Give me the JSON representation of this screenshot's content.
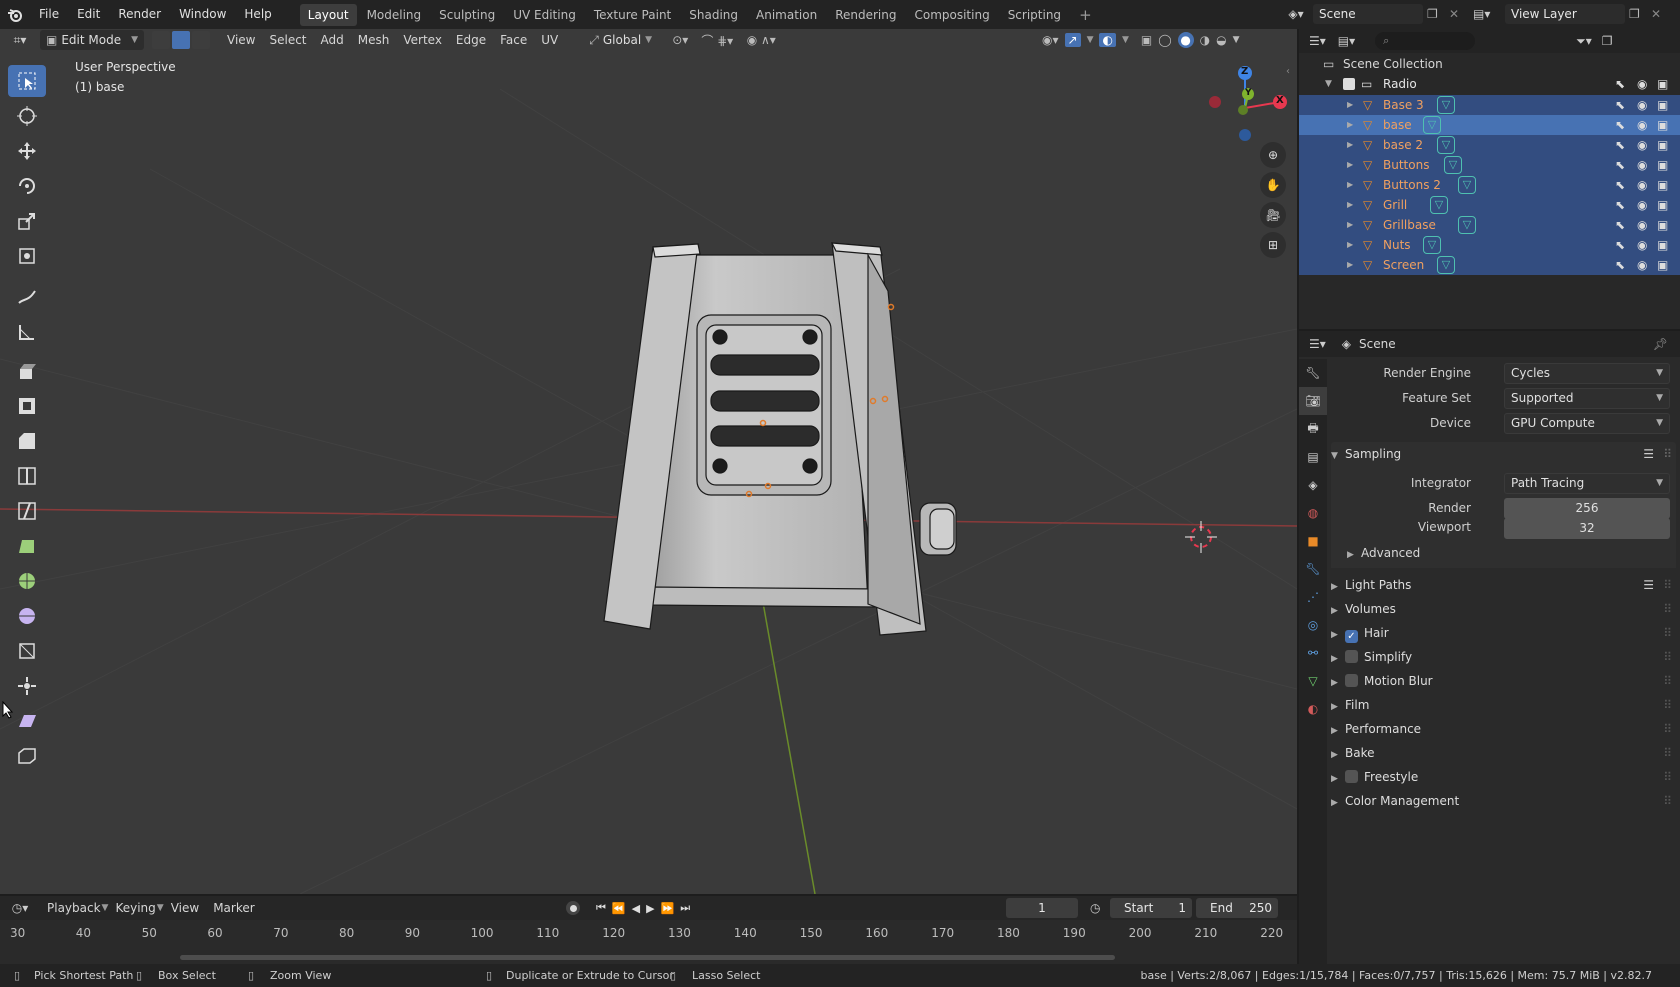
{
  "topbar": {
    "menus": [
      "File",
      "Edit",
      "Render",
      "Window",
      "Help"
    ],
    "workspaces": [
      "Layout",
      "Modeling",
      "Sculpting",
      "UV Editing",
      "Texture Paint",
      "Shading",
      "Animation",
      "Rendering",
      "Compositing",
      "Scripting"
    ],
    "active_workspace": "Layout",
    "add_tab": "+",
    "scene_name": "Scene",
    "view_layer_name": "View Layer"
  },
  "viewport": {
    "mode": "Edit Mode",
    "menus": [
      "View",
      "Select",
      "Add",
      "Mesh",
      "Vertex",
      "Edge",
      "Face",
      "UV"
    ],
    "orientation": "Global",
    "overlay_title": "User Perspective",
    "overlay_object": "(1) base",
    "gizmo_axes": {
      "x": "X",
      "y": "Y",
      "z": "Z"
    },
    "colors": {
      "x_axis": "#e8384f",
      "y_axis": "#7fb32d",
      "z_axis": "#3f84e5",
      "active_tool": "#4772b3"
    }
  },
  "tools": [
    "select-box-icon",
    "cursor-icon",
    "move-icon",
    "rotate-icon",
    "scale-icon",
    "transform-icon",
    "annotate-icon",
    "measure-icon",
    "extrude-icon",
    "inset-icon",
    "bevel-icon",
    "loop-cut-icon",
    "knife-icon",
    "poly-build-icon",
    "spin-icon",
    "smooth-icon",
    "edge-slide-icon",
    "shrink-fatten-icon",
    "shear-icon",
    "rip-region-icon"
  ],
  "outliner": {
    "root": "Scene Collection",
    "collection": "Radio",
    "objects": [
      {
        "name": "Base 3",
        "state": "selected"
      },
      {
        "name": "base",
        "state": "active"
      },
      {
        "name": "base 2",
        "state": "selected"
      },
      {
        "name": "Buttons",
        "state": "selected"
      },
      {
        "name": "Buttons 2",
        "state": "selected"
      },
      {
        "name": "Grill",
        "state": "selected"
      },
      {
        "name": "Grillbase",
        "state": "selected"
      },
      {
        "name": "Nuts",
        "state": "selected"
      },
      {
        "name": "Screen",
        "state": "selected"
      }
    ]
  },
  "properties": {
    "context": "Scene",
    "render_engine_label": "Render Engine",
    "render_engine": "Cycles",
    "feature_set_label": "Feature Set",
    "feature_set": "Supported",
    "device_label": "Device",
    "device": "GPU Compute",
    "sampling": {
      "title": "Sampling",
      "integrator_label": "Integrator",
      "integrator": "Path Tracing",
      "render_label": "Render",
      "render": "256",
      "viewport_label": "Viewport",
      "viewport": "32",
      "advanced": "Advanced"
    },
    "panels": [
      {
        "title": "Light Paths",
        "checkbox": null,
        "list": true
      },
      {
        "title": "Volumes",
        "checkbox": null
      },
      {
        "title": "Hair",
        "checkbox": true
      },
      {
        "title": "Simplify",
        "checkbox": false
      },
      {
        "title": "Motion Blur",
        "checkbox": false
      },
      {
        "title": "Film",
        "checkbox": null
      },
      {
        "title": "Performance",
        "checkbox": null
      },
      {
        "title": "Bake",
        "checkbox": null
      },
      {
        "title": "Freestyle",
        "checkbox": false
      },
      {
        "title": "Color Management",
        "checkbox": null
      }
    ]
  },
  "timeline": {
    "menus": [
      "Playback",
      "Keying",
      "View",
      "Marker"
    ],
    "current_frame": "1",
    "start_label": "Start",
    "start": "1",
    "end_label": "End",
    "end": "250",
    "ticks": [
      "30",
      "40",
      "50",
      "60",
      "70",
      "80",
      "90",
      "100",
      "110",
      "120",
      "130",
      "140",
      "150",
      "160",
      "170",
      "180",
      "190",
      "200",
      "210",
      "220"
    ]
  },
  "statusbar": {
    "hints": [
      "Pick Shortest Path",
      "Box Select",
      "Zoom View",
      "Duplicate or Extrude to Cursor",
      "Lasso Select"
    ],
    "stats": "base | Verts:2/8,067 | Edges:1/15,784 | Faces:0/7,757 | Tris:15,626 | Mem: 75.7 MiB | v2.82.7"
  }
}
